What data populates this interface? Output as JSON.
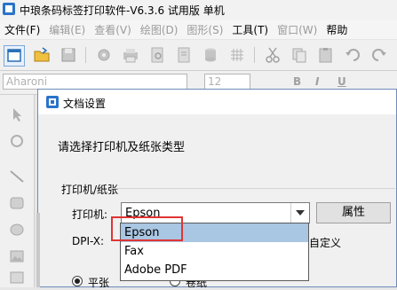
{
  "window": {
    "title": "中琅条码标签打印软件-V6.3.6 试用版 单机"
  },
  "menu": {
    "items": [
      {
        "label": "文件(F)",
        "enabled": true
      },
      {
        "label": "编辑(E)",
        "enabled": false
      },
      {
        "label": "查看(V)",
        "enabled": false
      },
      {
        "label": "绘图(D)",
        "enabled": false
      },
      {
        "label": "图形(S)",
        "enabled": false
      },
      {
        "label": "工具(T)",
        "enabled": true
      },
      {
        "label": "窗口(W)",
        "enabled": false
      },
      {
        "label": "帮助",
        "enabled": true
      }
    ]
  },
  "formatbar": {
    "font_value": "Aharoni",
    "size_value": "12",
    "bold": "B",
    "italic": "I",
    "underline": "U"
  },
  "dialog": {
    "title": "文档设置",
    "prompt": "请选择打印机及纸张类型",
    "group_label": "打印机/纸张",
    "printer_label": "打印机:",
    "printer_value": "Epson",
    "properties_button": "属性",
    "dpi_label": "DPI-X:",
    "custom_label": "自定义",
    "radio_flat": "平张",
    "radio_roll": "卷纸"
  },
  "dropdown": {
    "options": [
      "Epson",
      "Fax",
      "Adobe PDF"
    ],
    "selected_index": 0
  },
  "colors": {
    "highlight": "#e03434",
    "selected_row": "#a9c6e2",
    "app_icon": "#2b73c9"
  }
}
